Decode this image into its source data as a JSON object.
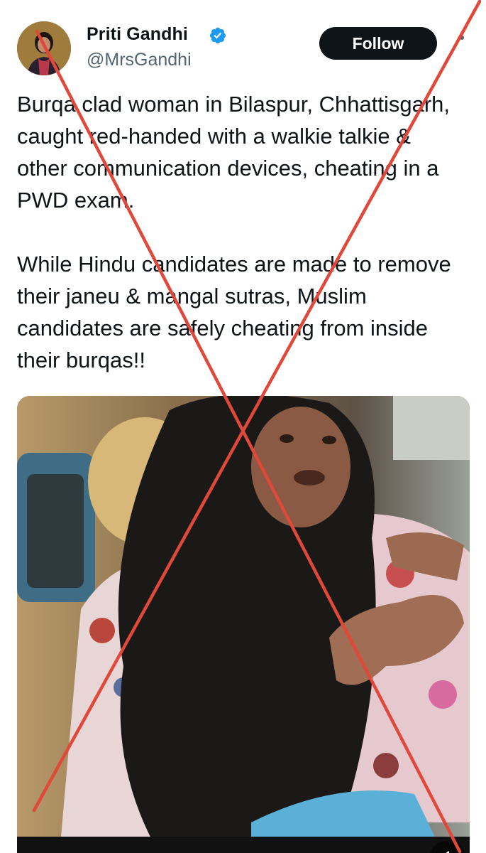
{
  "author": {
    "name": "Priti Gandhi",
    "handle": "@MrsGandhi",
    "verified": true
  },
  "follow_button": {
    "label": "Follow"
  },
  "tweet": {
    "paragraph_1": "Burqa clad woman in Bilaspur, Chhattisgarh, caught red-handed with a walkie talkie & other communication devices, cheating in a PWD exam.",
    "paragraph_2": "While Hindu candidates are made to remove their janeu & mangal sutras, Muslim candidates are safely cheating from inside their burqas!!"
  },
  "media": {
    "type": "video",
    "controls": {
      "mute_icon": "speaker-muted-icon"
    }
  },
  "overlay": {
    "icon": "red-x-cross",
    "color": "#e0483a"
  },
  "colors": {
    "follow_bg": "#0f1419",
    "verified_blue": "#1d9bf0",
    "handle_gray": "#536471"
  }
}
